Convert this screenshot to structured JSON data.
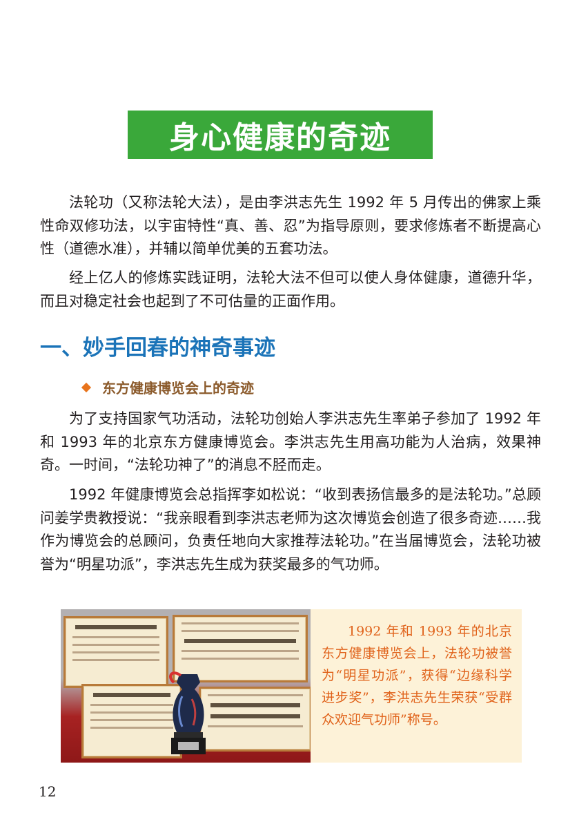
{
  "title": "身心健康的奇迹",
  "intro": {
    "p1": "法轮功（又称法轮大法），是由李洪志先生 1992 年 5 月传出的佛家上乘性命双修功法，以宇宙特性“真、善、忍”为指导原则，要求修炼者不断提高心性（道德水准），并辅以简单优美的五套功法。",
    "p2": "经上亿人的修炼实践证明，法轮大法不但可以使人身体健康，道德升华，而且对稳定社会也起到了不可估量的正面作用。"
  },
  "section": {
    "heading": "一、妙手回春的神奇事迹",
    "subheading": "东方健康博览会上的奇迹",
    "p3": "为了支持国家气功活动，法轮功创始人李洪志先生率弟子参加了 1992 年和 1993 年的北京东方健康博览会。李洪志先生用高功能为人治病，效果神奇。一时间，“法轮功神了”的消息不胫而走。",
    "p4": "1992 年健康博览会总指挥李如松说：“收到表扬信最多的是法轮功。”总顾问姜学贵教授说：“我亲眼看到李洪志老师为这次博览会创造了很多奇迹……我作为博览会的总顾问，负责任地向大家推荐法轮功。”在当届博览会，法轮功被誉为“明星功派”，李洪志先生成为获奖最多的气功师。"
  },
  "figure": {
    "caption": "1992 年和 1993 年的北京东方健康博览会上，法轮功被誉为“明星功派”，获得“边缘科学进步奖”，李洪志先生荣获“受群众欢迎气功师”称号。"
  },
  "page_number": "12",
  "colors": {
    "title_bg": "#3aa83a",
    "section_heading": "#1a73b8",
    "subheading": "#8b5a2b",
    "bullet": "#e8741c",
    "caption_text": "#e0621a",
    "caption_bg": "#fdf2d8"
  }
}
